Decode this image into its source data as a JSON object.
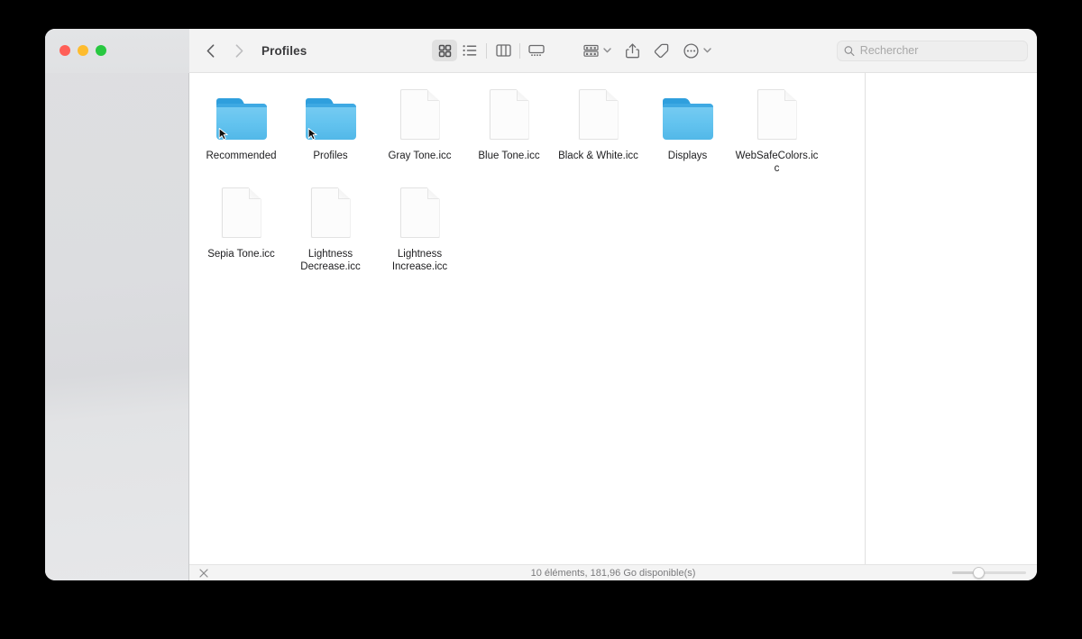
{
  "window": {
    "title": "Profiles",
    "traffic_lights": [
      {
        "name": "close",
        "color": "#ff5f57"
      },
      {
        "name": "minimize",
        "color": "#febc2e"
      },
      {
        "name": "maximize",
        "color": "#28c840"
      }
    ]
  },
  "toolbar": {
    "back_label": "Back",
    "forward_label": "Forward",
    "path_title": "Profiles",
    "view_buttons": [
      {
        "name": "icon-view",
        "label": "Icon View",
        "active": true
      },
      {
        "name": "list-view",
        "label": "List View",
        "active": false
      },
      {
        "name": "column-view",
        "label": "Column View",
        "active": false
      },
      {
        "name": "gallery-view",
        "label": "Gallery View",
        "active": false
      }
    ],
    "group_button_label": "Group",
    "share_button_label": "Share",
    "tags_button_label": "Tags",
    "more_button_label": "More"
  },
  "search": {
    "placeholder": "Rechercher",
    "value": ""
  },
  "files": [
    {
      "name": "Recommended",
      "type": "folder",
      "alias": true
    },
    {
      "name": "Profiles",
      "type": "folder",
      "alias": true
    },
    {
      "name": "Gray Tone.icc",
      "type": "document",
      "alias": false
    },
    {
      "name": "Blue Tone.icc",
      "type": "document",
      "alias": false
    },
    {
      "name": "Black & White.icc",
      "type": "document",
      "alias": false
    },
    {
      "name": "Displays",
      "type": "folder",
      "alias": false
    },
    {
      "name": "WebSafeColors.icc",
      "type": "document",
      "alias": false
    },
    {
      "name": "Sepia Tone.icc",
      "type": "document",
      "alias": false
    },
    {
      "name": "Lightness Decrease.icc",
      "type": "document",
      "alias": false
    },
    {
      "name": "Lightness Increase.icc",
      "type": "document",
      "alias": false
    }
  ],
  "status": {
    "close_label": "Close",
    "text": "10 éléments, 181,96 Go disponible(s)",
    "zoom_slider_value": 28
  },
  "colors": {
    "folder_blue": "#63c3ef",
    "folder_tab": "#2f9fdd",
    "toolbar_bg": "#f3f3f3",
    "sidebar_bg": "#dcdde0",
    "content_bg": "#ffffff",
    "text": "#1d1d1f",
    "muted_text": "#7a7a7c"
  }
}
